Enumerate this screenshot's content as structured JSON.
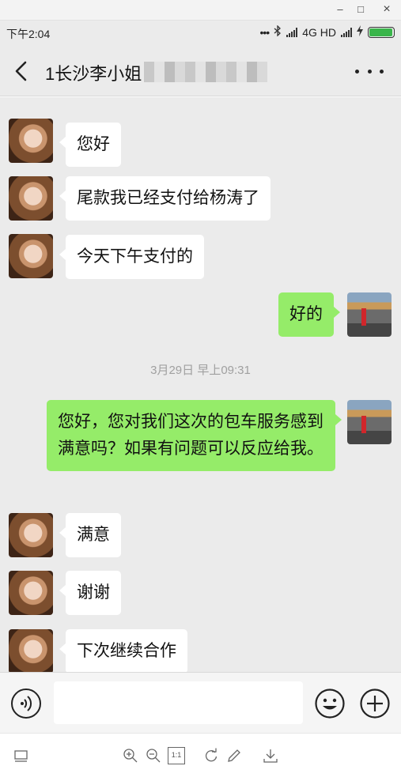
{
  "window": {
    "minimize_glyph": "–",
    "maximize_glyph": "□",
    "close_glyph": "×"
  },
  "status_bar": {
    "time": "下午2:04",
    "dots": "•••",
    "network_label": "4G HD",
    "battery_level": 0.95,
    "battery_color": "#39b54a"
  },
  "header": {
    "title": "1长沙李小姐",
    "back_icon": "chevron-left-icon",
    "more_icon": "more-dots-icon"
  },
  "messages": [
    {
      "side": "in",
      "text": "您好"
    },
    {
      "side": "in",
      "text": "尾款我已经支付给杨涛了"
    },
    {
      "side": "in",
      "text": "今天下午支付的"
    },
    {
      "side": "out",
      "text": "好的"
    },
    {
      "side": "time",
      "text": "3月29日 早上09:31"
    },
    {
      "side": "out",
      "text": "您好，您对我们这次的包车服务感到满意吗？如果有问题可以反应给我。"
    },
    {
      "side": "in",
      "text": "满意"
    },
    {
      "side": "in",
      "text": "谢谢"
    },
    {
      "side": "in",
      "text": "下次继续合作"
    }
  ],
  "input_bar": {
    "text_value": "",
    "voice_icon": "voice-icon",
    "emoji_icon": "emoji-icon",
    "plus_icon": "plus-circle-icon"
  },
  "toolbar": {
    "icons": [
      "window-icon",
      "zoom-in-icon",
      "zoom-out-icon",
      "actual-size-icon",
      "rotate-icon",
      "edit-icon",
      "download-icon"
    ],
    "actual_size_label": "1:1"
  },
  "colors": {
    "chat_background": "#ebebeb",
    "outgoing_bubble": "#95ec69",
    "incoming_bubble": "#ffffff"
  }
}
